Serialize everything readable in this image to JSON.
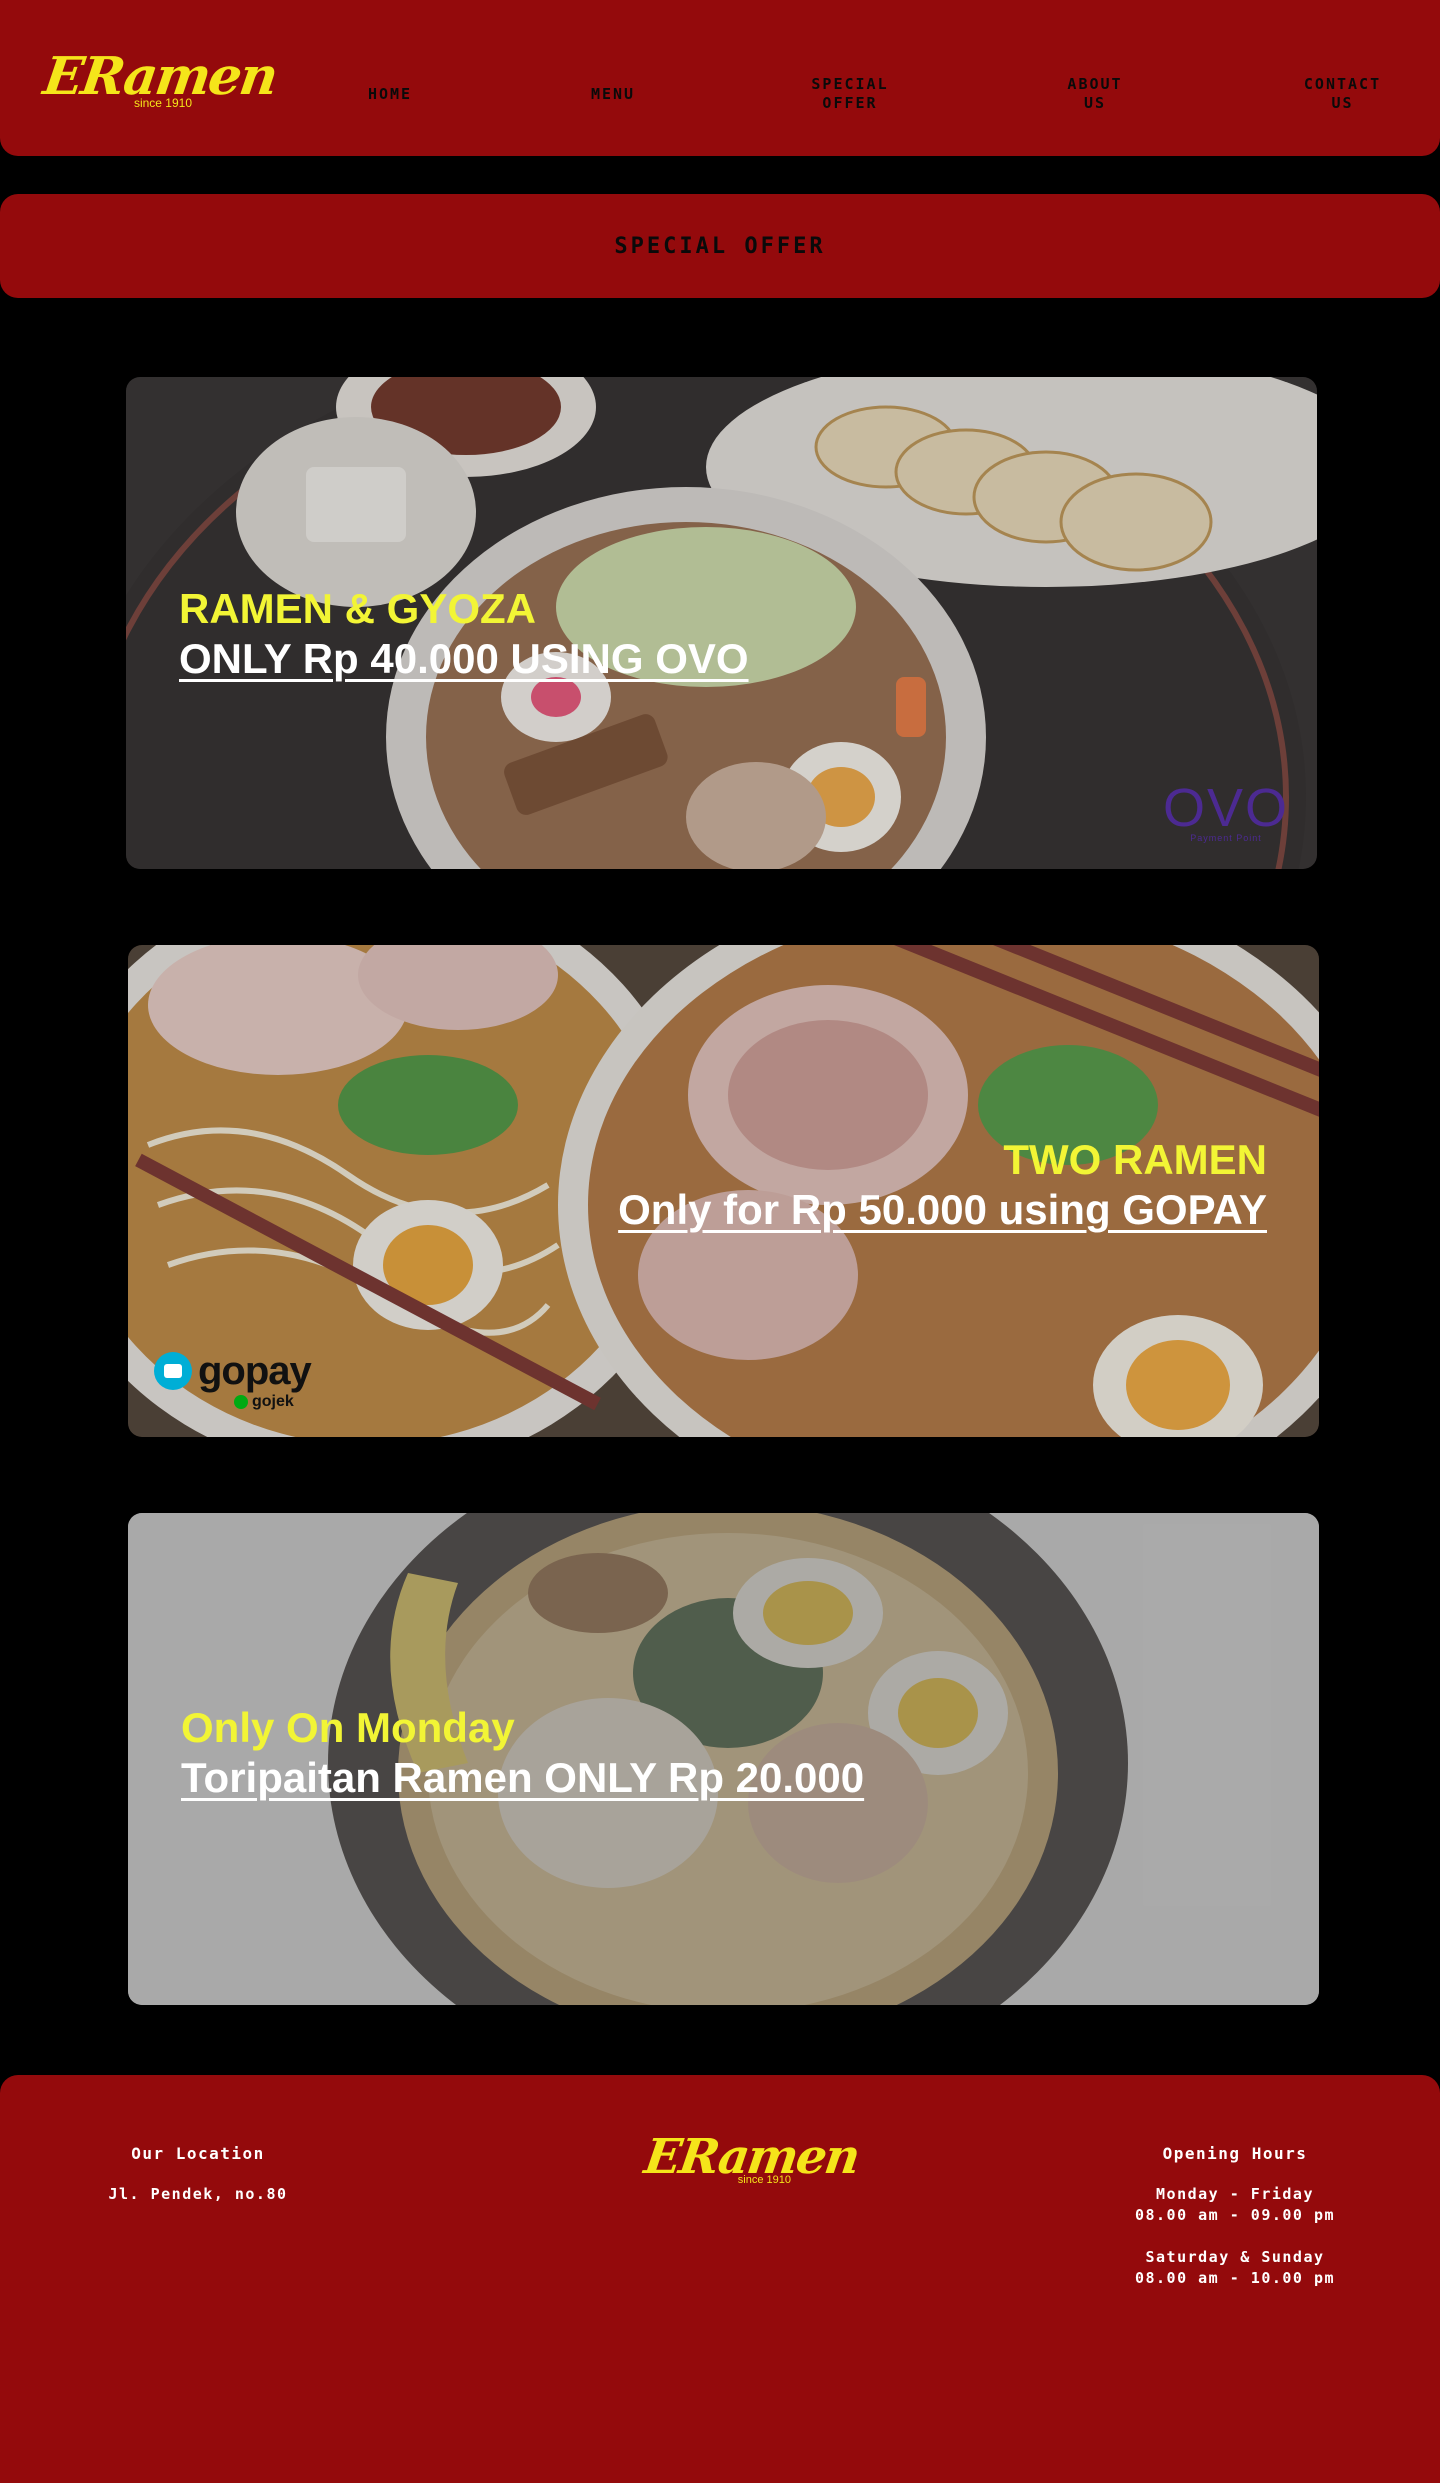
{
  "brand": {
    "name": "ERamen",
    "since": "since 1910",
    "color": "#f5e51a"
  },
  "theme": {
    "primary": "#940a0c",
    "background": "#000000",
    "highlight": "#f2f535"
  },
  "nav": {
    "home": "HOME",
    "menu": "MENU",
    "special_offer_1": "SPECIAL",
    "special_offer_2": "OFFER",
    "about_1": "ABOUT",
    "about_2": "US",
    "contact_1": "CONTACT",
    "contact_2": "US"
  },
  "banner": {
    "title": "SPECIAL OFFER"
  },
  "offers": [
    {
      "headline": "RAMEN & GYOZA",
      "subline": "ONLY Rp 40.000 USING OVO",
      "badge": "OVO",
      "badge_tag": "Payment Point",
      "badge_icon": "ovo-logo"
    },
    {
      "headline": "TWO RAMEN",
      "subline": "Only for Rp 50.000 using GOPAY",
      "badge": "gopay",
      "badge_tag": "gojek",
      "badge_icon": "gopay-logo"
    },
    {
      "headline": "Only On Monday",
      "subline": "Toripaitan Ramen ONLY Rp 20.000"
    }
  ],
  "footer": {
    "location_title": "Our Location",
    "address": "Jl. Pendek, no.80",
    "hours_title": "Opening Hours",
    "weekday_label": "Monday - Friday",
    "weekday_hours": "08.00 am - 09.00 pm",
    "weekend_label": "Saturday & Sunday",
    "weekend_hours": "08.00 am - 10.00 pm"
  }
}
